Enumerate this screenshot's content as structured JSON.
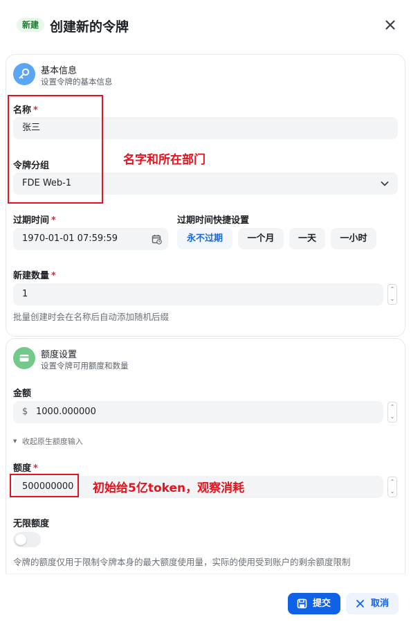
{
  "header": {
    "badge": "新建",
    "title": "创建新的令牌"
  },
  "basic": {
    "title": "基本信息",
    "subtitle": "设置令牌的基本信息",
    "name_label": "名称",
    "name_value": "张三",
    "group_label": "令牌分组",
    "group_value": "FDE Web-1",
    "expire_label": "过期时间",
    "expire_value": "1970-01-01 07:59:59",
    "quick_label": "过期时间快捷设置",
    "quick_options": [
      "永不过期",
      "一个月",
      "一天",
      "一小时"
    ],
    "count_label": "新建数量",
    "count_value": "1",
    "count_help": "批量创建时会在名称后自动添加随机后缀"
  },
  "quota": {
    "title": "额度设置",
    "subtitle": "设置令牌可用额度和数量",
    "amount_label": "金额",
    "currency": "$",
    "amount_value": "1000.000000",
    "collapse_text": "收起原生额度输入",
    "quota_label": "额度",
    "quota_value": "500000000",
    "unlimited_label": "无限额度",
    "unlimited_on": false,
    "footnote": "令牌的额度仅用于限制令牌本身的最大额度使用量，实际的使用受到账户的剩余额度限制"
  },
  "annotations": {
    "name_group_note": "名字和所在部门",
    "quota_note": "初始给5亿token，观察消耗"
  },
  "actions": {
    "submit": "提交",
    "cancel": "取消"
  },
  "colors": {
    "accent": "#0f62e6",
    "annotation": "#e8111d",
    "badge_bg": "#e8f7ea",
    "required": "#e0263b"
  }
}
